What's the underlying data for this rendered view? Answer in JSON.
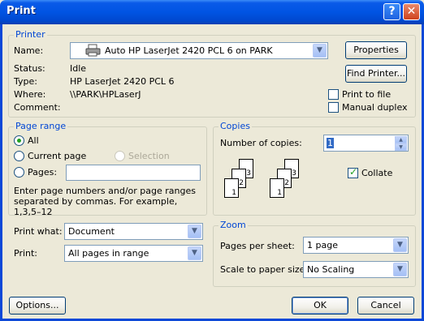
{
  "window": {
    "title": "Print"
  },
  "titlebar": {
    "help_glyph": "?",
    "close_glyph": "✕"
  },
  "printer": {
    "group_label": "Printer",
    "name_label": "Name:",
    "name_value": "Auto HP LaserJet 2420 PCL 6 on PARK",
    "status_label": "Status:",
    "status_value": "Idle",
    "type_label": "Type:",
    "type_value": "HP LaserJet 2420 PCL 6",
    "where_label": "Where:",
    "where_value": "\\\\PARK\\HPLaserJ",
    "comment_label": "Comment:",
    "comment_value": "",
    "properties_button": "Properties",
    "find_printer_button": "Find Printer...",
    "print_to_file_label": "Print to file",
    "print_to_file_checked": false,
    "manual_duplex_label": "Manual duplex",
    "manual_duplex_checked": false
  },
  "page_range": {
    "group_label": "Page range",
    "all_label": "All",
    "current_page_label": "Current page",
    "selection_label": "Selection",
    "pages_label": "Pages:",
    "pages_value": "",
    "hint": "Enter page numbers and/or page ranges separated by commas.  For example, 1,3,5–12",
    "selected": "All"
  },
  "copies": {
    "group_label": "Copies",
    "number_label": "Number of copies:",
    "number_value": "1",
    "collate_label": "Collate",
    "collate_checked": true,
    "page_labels": [
      "3",
      "2",
      "1"
    ]
  },
  "print_what": {
    "label": "Print what:",
    "value": "Document"
  },
  "print": {
    "label": "Print:",
    "value": "All pages in range"
  },
  "zoom": {
    "group_label": "Zoom",
    "pages_per_sheet_label": "Pages per sheet:",
    "pages_per_sheet_value": "1 page",
    "scale_label": "Scale to paper size:",
    "scale_value": "No Scaling"
  },
  "footer": {
    "options_button": "Options...",
    "ok_button": "OK",
    "cancel_button": "Cancel"
  },
  "colors": {
    "accent": "#0054E3",
    "group_label": "#0046D5",
    "dialog_bg": "#ECE9D8"
  },
  "icons": {
    "printer": "printer-icon",
    "dropdown": "chevron-down-icon"
  }
}
